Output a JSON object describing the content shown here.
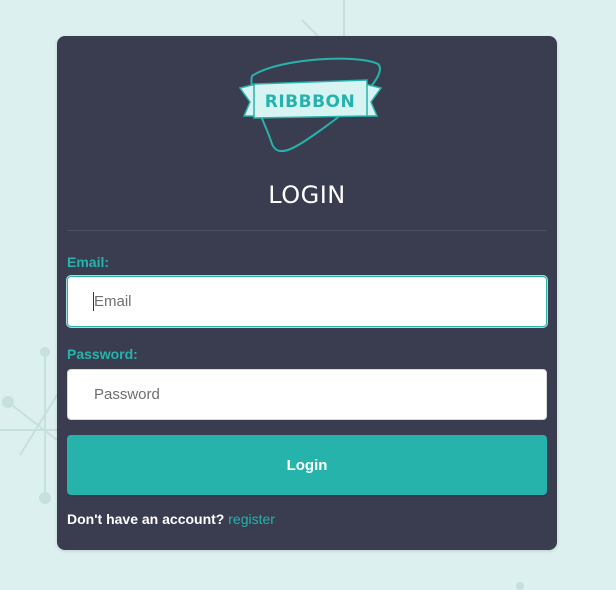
{
  "app": {
    "logo_text": "RIBBBON"
  },
  "page": {
    "title": "LOGIN"
  },
  "form": {
    "email_label": "Email:",
    "email_placeholder": "Email",
    "email_value": "",
    "password_label": "Password:",
    "password_placeholder": "Password",
    "password_value": "",
    "submit_label": "Login"
  },
  "footer": {
    "prompt": "Don't have an account?",
    "link_label": "register"
  },
  "colors": {
    "accent": "#26b3ac",
    "card_bg": "#3a3d4f",
    "page_bg": "#dcf0ef"
  }
}
